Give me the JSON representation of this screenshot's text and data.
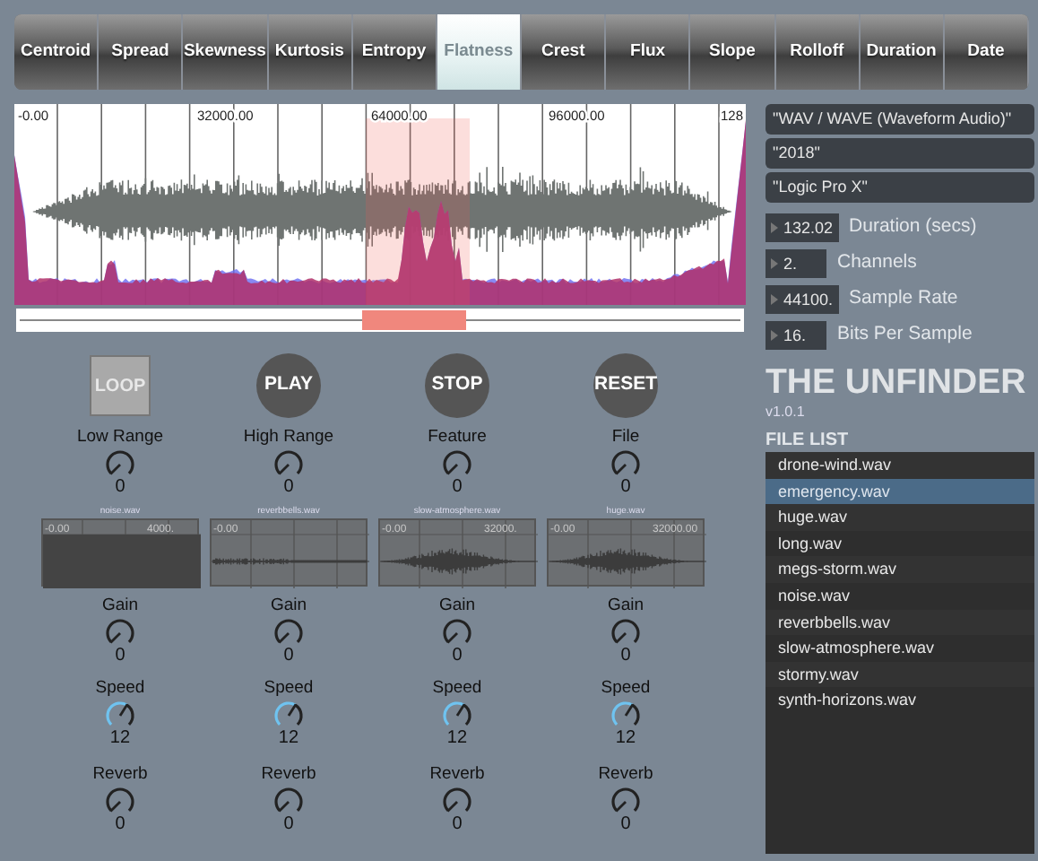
{
  "tabs": [
    {
      "label": "Centroid",
      "selected": false
    },
    {
      "label": "Spread",
      "selected": false
    },
    {
      "label": "Skewness",
      "selected": false
    },
    {
      "label": "Kurtosis",
      "selected": false
    },
    {
      "label": "Entropy",
      "selected": false
    },
    {
      "label": "Flatness",
      "selected": true
    },
    {
      "label": "Crest",
      "selected": false
    },
    {
      "label": "Flux",
      "selected": false
    },
    {
      "label": "Slope",
      "selected": false
    },
    {
      "label": "Rolloff",
      "selected": false
    },
    {
      "label": "Duration",
      "selected": false
    },
    {
      "label": "Date",
      "selected": false
    }
  ],
  "waveform": {
    "ticks": [
      "-0.00",
      "32000.00",
      "64000.00",
      "96000.00",
      "128"
    ]
  },
  "columns": [
    {
      "button": {
        "label": "LOOP",
        "kind": "toggle"
      },
      "range_knob": {
        "label": "Low Range",
        "value": "0",
        "kind": "plain"
      },
      "clip": {
        "title": "noise.wav",
        "kind": "noise",
        "ticks": [
          "-0.00",
          "4000."
        ]
      },
      "knobs": [
        {
          "label": "Gain",
          "value": "0",
          "kind": "plain"
        },
        {
          "label": "Speed",
          "value": "12",
          "kind": "accent"
        },
        {
          "label": "Reverb",
          "value": "0",
          "kind": "plain"
        }
      ]
    },
    {
      "button": {
        "label": "PLAY",
        "kind": "round"
      },
      "range_knob": {
        "label": "High Range",
        "value": "0",
        "kind": "plain"
      },
      "clip": {
        "title": "reverbbells.wav",
        "kind": "sparse",
        "ticks": [
          "-0.00"
        ]
      },
      "knobs": [
        {
          "label": "Gain",
          "value": "0",
          "kind": "plain"
        },
        {
          "label": "Speed",
          "value": "12",
          "kind": "accent"
        },
        {
          "label": "Reverb",
          "value": "0",
          "kind": "plain"
        }
      ]
    },
    {
      "button": {
        "label": "STOP",
        "kind": "round"
      },
      "range_knob": {
        "label": "Feature",
        "value": "0",
        "kind": "plain"
      },
      "clip": {
        "title": "slow-atmosphere.wav",
        "kind": "swell",
        "ticks": [
          "-0.00",
          "32000."
        ]
      },
      "knobs": [
        {
          "label": "Gain",
          "value": "0",
          "kind": "plain"
        },
        {
          "label": "Speed",
          "value": "12",
          "kind": "accent"
        },
        {
          "label": "Reverb",
          "value": "0",
          "kind": "plain"
        }
      ]
    },
    {
      "button": {
        "label": "RESET",
        "kind": "round"
      },
      "range_knob": {
        "label": "File",
        "value": "0",
        "kind": "plain"
      },
      "clip": {
        "title": "huge.wav",
        "kind": "swell",
        "ticks": [
          "-0.00",
          "32000.00"
        ]
      },
      "knobs": [
        {
          "label": "Gain",
          "value": "0",
          "kind": "plain"
        },
        {
          "label": "Speed",
          "value": "12",
          "kind": "accent"
        },
        {
          "label": "Reverb",
          "value": "0",
          "kind": "plain"
        }
      ]
    }
  ],
  "info_fields": [
    "\"WAV / WAVE (Waveform Audio)\"",
    "\"2018\"",
    "\"Logic Pro X\""
  ],
  "number_fields": [
    {
      "value": "132.02",
      "label": "Duration (secs)"
    },
    {
      "value": "2.",
      "label": "Channels"
    },
    {
      "value": "44100.",
      "label": "Sample Rate"
    },
    {
      "value": "16.",
      "label": "Bits Per Sample"
    }
  ],
  "app_title": "THE UNFINDER",
  "version": "v1.0.1",
  "file_list": {
    "heading": "FILE LIST",
    "items": [
      {
        "name": "drone-wind.wav",
        "selected": false
      },
      {
        "name": "emergency.wav",
        "selected": true
      },
      {
        "name": "huge.wav",
        "selected": false
      },
      {
        "name": "long.wav",
        "selected": false
      },
      {
        "name": "megs-storm.wav",
        "selected": false
      },
      {
        "name": "noise.wav",
        "selected": false
      },
      {
        "name": "reverbbells.wav",
        "selected": false
      },
      {
        "name": "slow-atmosphere.wav",
        "selected": false
      },
      {
        "name": "stormy.wav",
        "selected": false
      },
      {
        "name": "synth-horizons.wav",
        "selected": false
      }
    ]
  }
}
